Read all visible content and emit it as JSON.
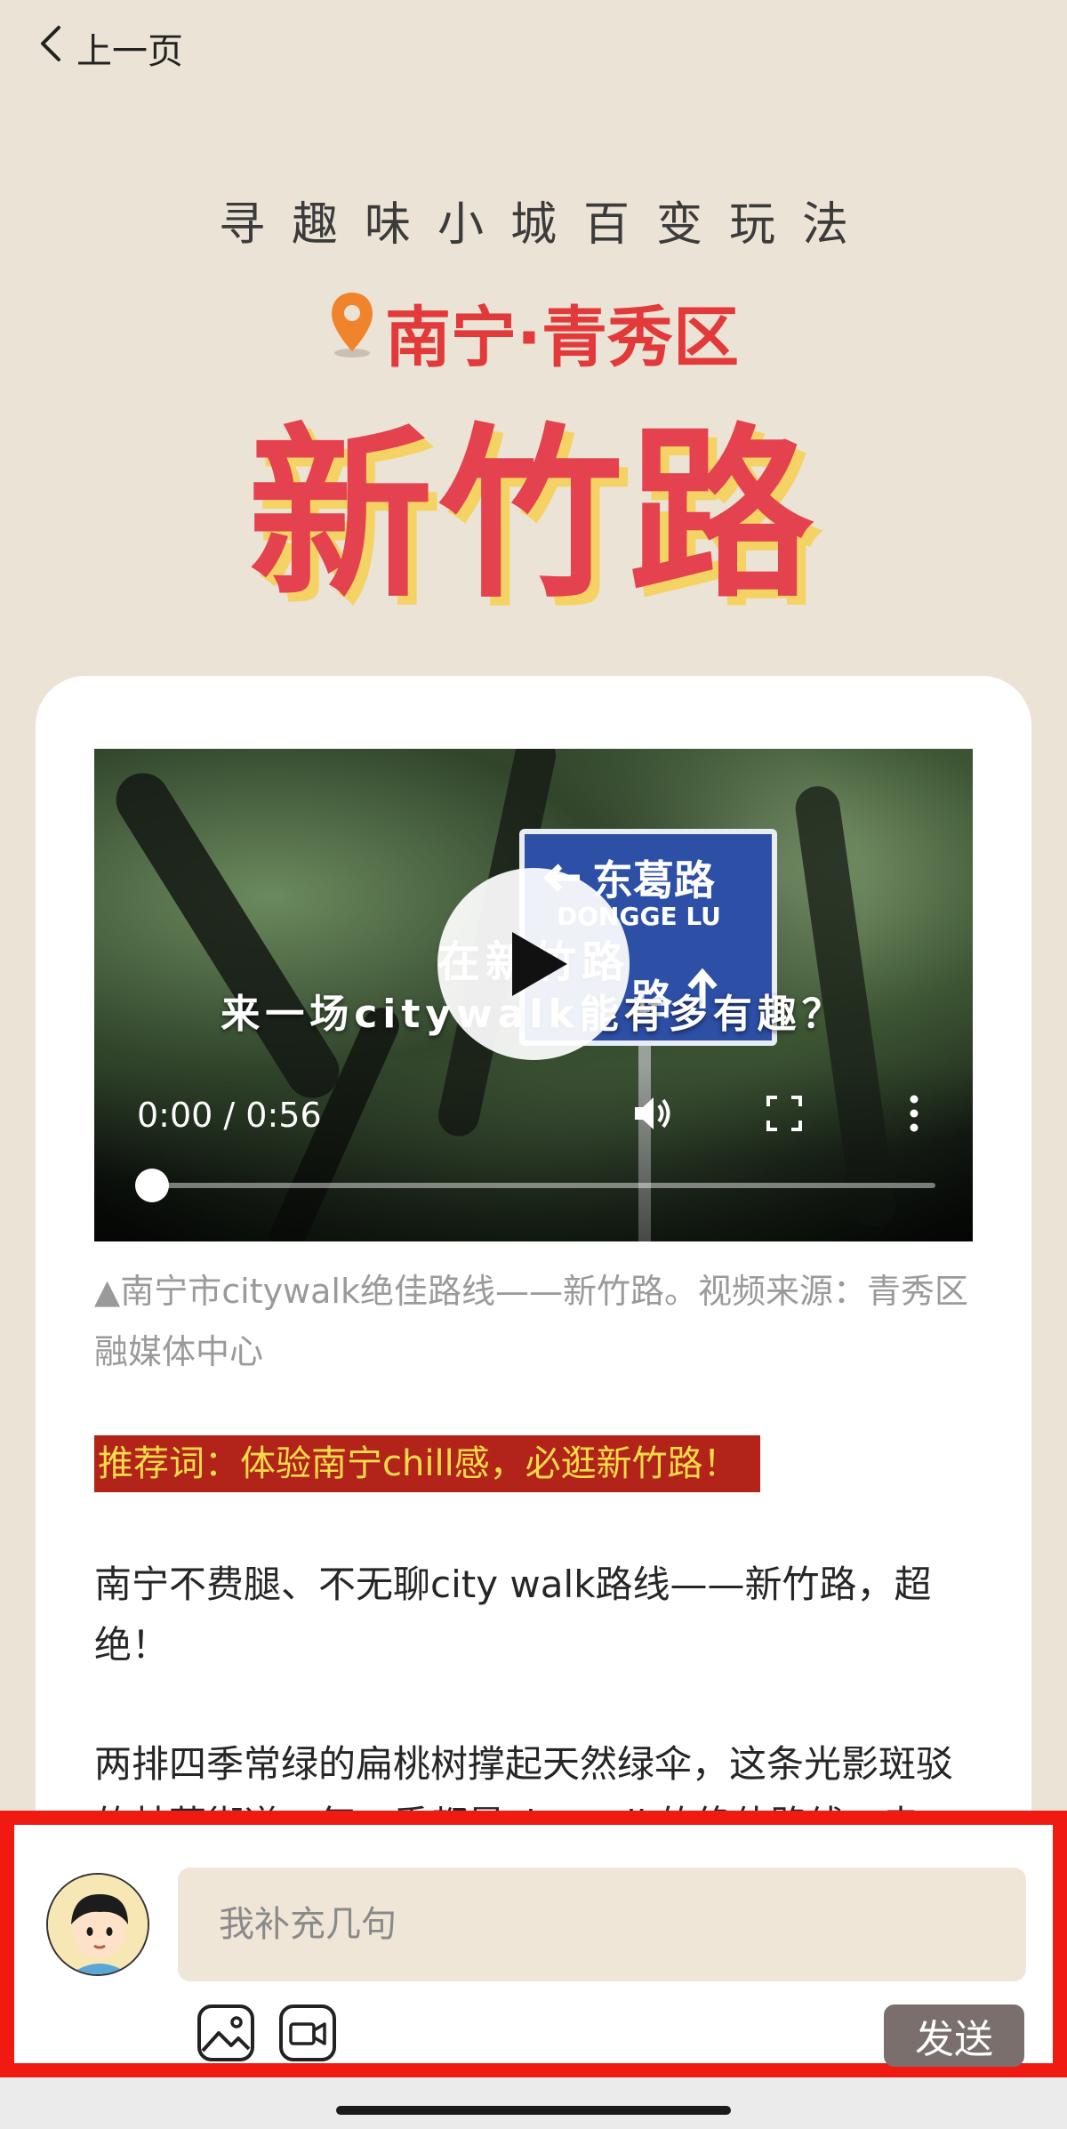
{
  "nav": {
    "back_label": "上一页"
  },
  "hero": {
    "subtitle": "寻趣味小城百变玩法",
    "location": "南宁·青秀区",
    "title": "新竹路"
  },
  "video": {
    "sign_line1": "东葛路",
    "sign_line2": "DONGGE LU",
    "sign_line3": "路",
    "overlay_line1": "在新竹路",
    "overlay_line2": "来一场citywalk能有多有趣？",
    "time": "0:00 / 0:56",
    "progress": 0.02,
    "icons": [
      "play-icon",
      "volume-icon",
      "fullscreen-icon",
      "more-vertical-icon"
    ]
  },
  "article": {
    "caption": "▲南宁市citywalk绝佳路线——新竹路。视频来源：青秀区融媒体中心",
    "highlight": "推荐词：体验南宁chill感，必逛新竹路！",
    "para1": "南宁不费腿、不无聊city walk路线——新竹路，超绝！",
    "para2": "两排四季常绿的扁桃树撑起天然绿伞，这条光影斑驳的林荫街道，每一季都是citywalk的绝佳路线。走"
  },
  "comment": {
    "placeholder": "我补充几句",
    "send_label": "发送",
    "icons": [
      "image-icon",
      "video-camera-icon"
    ]
  },
  "colors": {
    "page_bg": "#ebe3d6",
    "hero_red": "#e4424e",
    "highlight_bg": "#b2231a",
    "highlight_text": "#f9dc4a",
    "input_bg": "#efe6d7",
    "send_bg": "#7a6f6c",
    "outline_red": "#f11a12"
  }
}
